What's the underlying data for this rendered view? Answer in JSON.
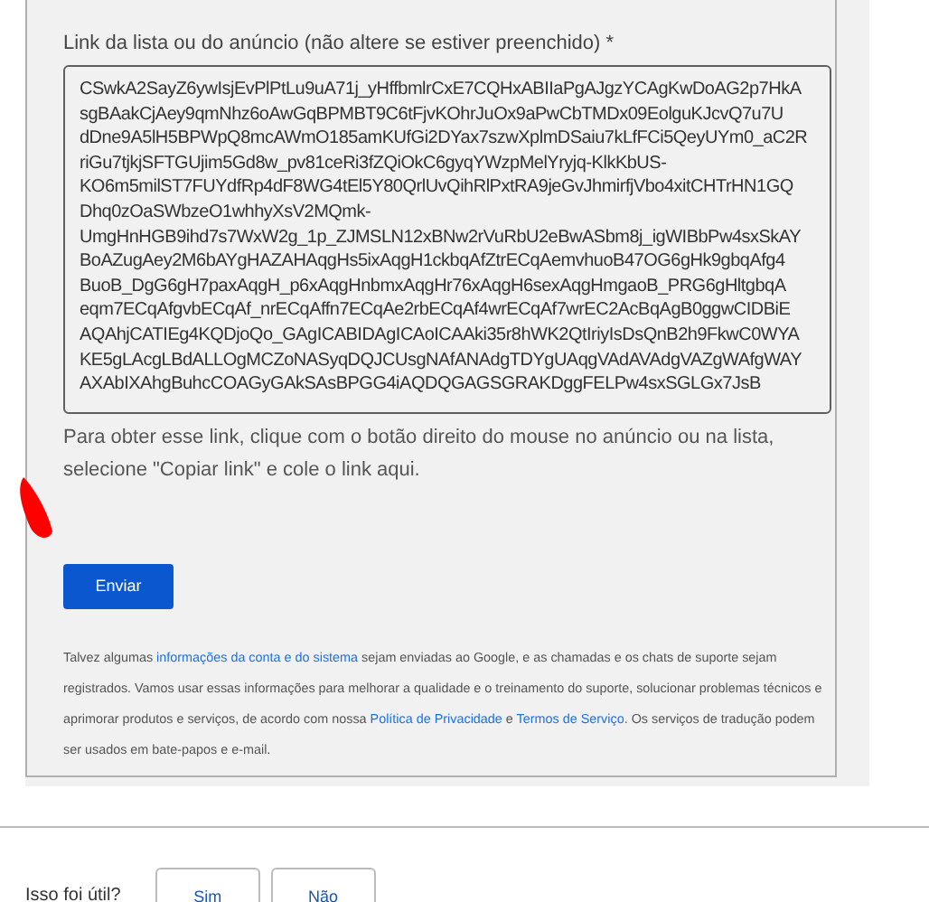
{
  "form": {
    "field_label": "Link da lista ou do anúncio (não altere se estiver preenchido) *",
    "field_value": "CSwkA2SayZ6ywIsjEvPlPtLu9uA71j_yHffbmlrCxE7CQHxABIIaPgAJgzYCAgKwDoAG2p7HkA\nsgBAakCjAey9qmNhz6oAwGqBPMBT9C6tFjvKOhrJuOx9aPwCbTMDx09EolguKJcvQ7u7U\ndDne9A5lH5BPWpQ8mcAWmO185amKUfGi2DYax7szwXplmDSaiu7kLfFCi5QeyUYm0_aC2R\nriGu7tjkjSFTGUjim5Gd8w_pv81ceRi3fZQiOkC6gyqYWzpMelYryjq-KlkKbUS-\nKO6m5milST7FUYdfRp4dF8WG4tEl5Y80QrlUvQihRlPxtRA9jeGvJhmirfjVbo4xitCHTrHN1GQ\nDhq0zOaSWbzeO1whhyXsV2MQmk-\nUmgHnHGB9ihd7s7WxW2g_1p_ZJMSLN12xBNw2rVuRbU2eBwASbm8j_igWIBbPw4sxSkAY\nBoAZugAey2M6bAYgHAZAHAqgHs5ixAqgH1ckbqAfZtrECqAemvhuoB47OG6gHk9gbqAfg4\nBuoB_DgG6gH7paxAqgH_p6xAqgHnbmxAqgHr76xAqgH6sexAqgHmgaoB_PRG6gHltgbqA\neqm7ECqAfgvbECqAf_nrECqAffn7ECqAe2rbECqAf4wrECqAf7wrEC2AcBqAgB0ggwCIDBiE\nAQAhjCATIEg4KQDjoQo_GAgICABIDAgICAoICAAki35r8hWK2QtIriyIsDsQnB2h9FkwC0WYA\nKE5gLAcgLBdALLOgMCZoNASyqDQJCUsgNAfANAdgTDYgUAqgVAdAVAdgVAZgWAfgWAY\nAXAbIXAhgBuhcCOAGyGAkSAsBPGG4iAQDQGAGSGRAKDggFELPw4sxSGLGx7JsB",
    "hint": "Para obter esse link, clique com o botão direito do mouse no anúncio ou na lista, selecione \"Copiar link\" e cole o link aqui.",
    "submit": "Enviar",
    "disclaimer": [
      {
        "kind": "text",
        "text": "Talvez algumas "
      },
      {
        "kind": "link",
        "text": "informações da conta e do sistema"
      },
      {
        "kind": "text",
        "text": " sejam enviadas ao Google, e as chamadas e os chats de suporte sejam registrados. Vamos usar essas informações para melhorar a qualidade e o treinamento do suporte, solucionar problemas técnicos e aprimorar produtos e serviços, de acordo com nossa "
      },
      {
        "kind": "link",
        "text": "Política de Privacidade"
      },
      {
        "kind": "text",
        "text": " e "
      },
      {
        "kind": "link",
        "text": "Termos de Serviço"
      },
      {
        "kind": "text",
        "text": ". Os serviços de tradução podem ser usados em bate-papos e e-mail."
      }
    ]
  },
  "feedback": {
    "question": "Isso foi útil?",
    "buttons": [
      "Sim",
      "Não"
    ]
  }
}
